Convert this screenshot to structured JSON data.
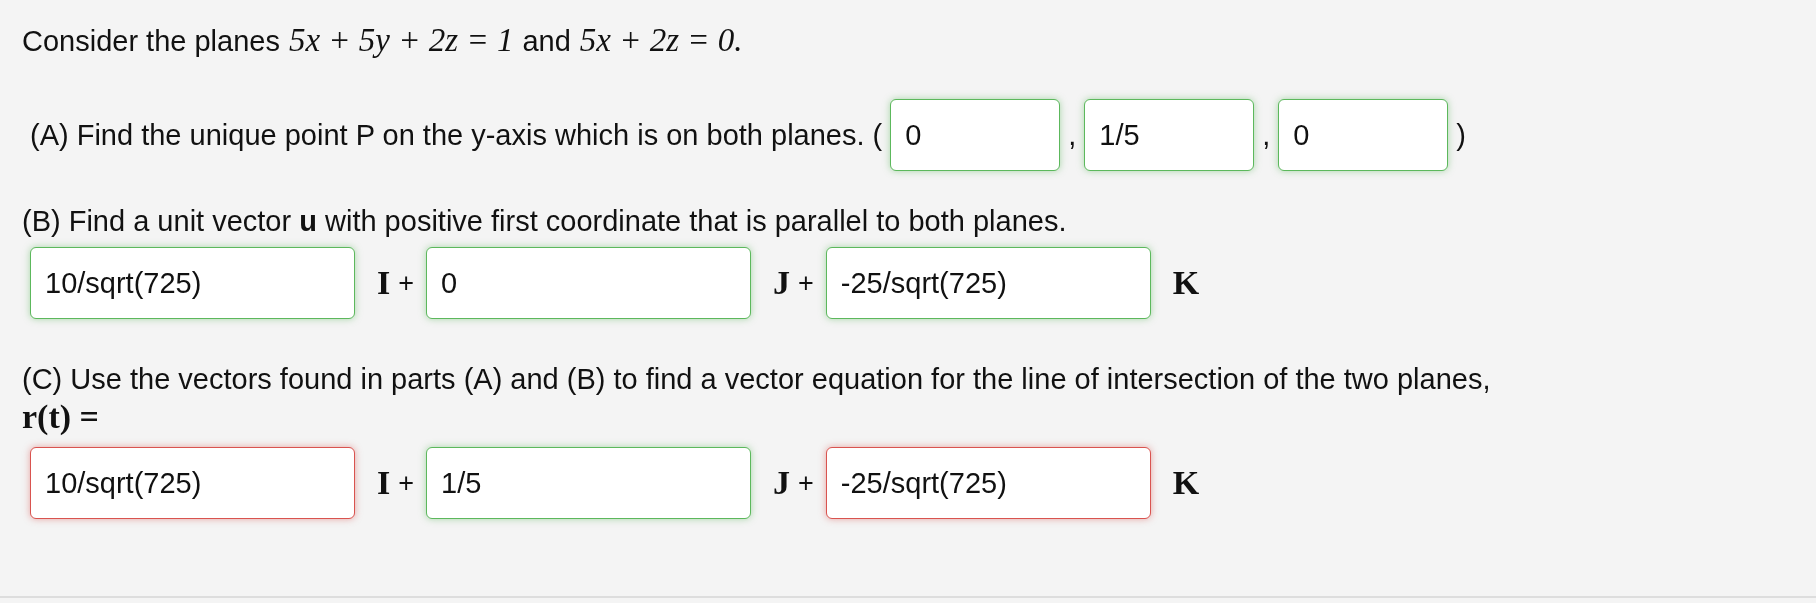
{
  "intro": [
    {
      "kind": "text",
      "text": "Consider the planes"
    },
    {
      "kind": "math",
      "text": "5x + 5y + 2z = 1"
    },
    {
      "kind": "text",
      "text": "and"
    },
    {
      "kind": "math",
      "text": "5x + 2z = 0."
    }
  ],
  "part_a": {
    "items": [
      {
        "kind": "text",
        "text": "(A) Find the unique point P on the y-axis which is on both planes. ("
      },
      {
        "kind": "field",
        "value": "0",
        "correct": true
      },
      {
        "kind": "text",
        "text": ","
      },
      {
        "kind": "field",
        "value": "1/5",
        "correct": true
      },
      {
        "kind": "text",
        "text": ","
      },
      {
        "kind": "field",
        "value": "0",
        "correct": true
      },
      {
        "kind": "text",
        "text": ")"
      }
    ]
  },
  "part_b": {
    "text": "(B) Find a unit vector **u** with positive first coordinate that is parallel to both planes.",
    "terms": [
      {
        "value": "10/sqrt(725)",
        "correct": true,
        "unit": "I",
        "plus": "+"
      },
      {
        "value": "0",
        "correct": true,
        "unit": "J",
        "plus": "+"
      },
      {
        "value": "-25/sqrt(725)",
        "correct": true,
        "unit": "K"
      }
    ]
  },
  "part_c": {
    "text": "(C) Use the vectors found in parts (A) and (B) to find a vector equation for the line of intersection of the two planes,",
    "lhs": "r(t) =",
    "terms": [
      {
        "value": "10/sqrt(725)",
        "correct": false,
        "unit": "I",
        "plus": "+"
      },
      {
        "value": "1/5",
        "correct": true,
        "unit": "J",
        "plus": "+"
      },
      {
        "value": "-25/sqrt(725)",
        "correct": false,
        "unit": "K"
      }
    ]
  }
}
